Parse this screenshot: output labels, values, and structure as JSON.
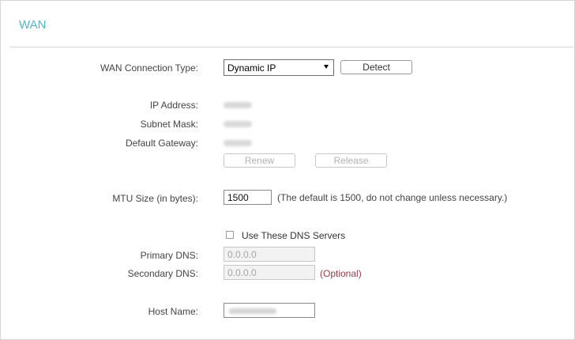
{
  "page": {
    "title": "WAN"
  },
  "connection": {
    "label": "WAN Connection Type:",
    "selected": "Dynamic IP",
    "detect_button": "Detect"
  },
  "status": {
    "ip_label": "IP Address:",
    "subnet_label": "Subnet Mask:",
    "gateway_label": "Default Gateway:",
    "renew_button": "Renew",
    "release_button": "Release"
  },
  "mtu": {
    "label": "MTU Size (in bytes):",
    "value": "1500",
    "hint": "(The default is 1500, do not change unless necessary.)"
  },
  "dns": {
    "checkbox_label": "Use These DNS Servers",
    "checked": false,
    "primary_label": "Primary DNS:",
    "primary_placeholder": "0.0.0.0",
    "secondary_label": "Secondary DNS:",
    "secondary_placeholder": "0.0.0.0",
    "optional_note": "(Optional)"
  },
  "host": {
    "label": "Host Name:"
  },
  "colors": {
    "title": "#4fb6c4",
    "optional": "#9a3a4a"
  }
}
